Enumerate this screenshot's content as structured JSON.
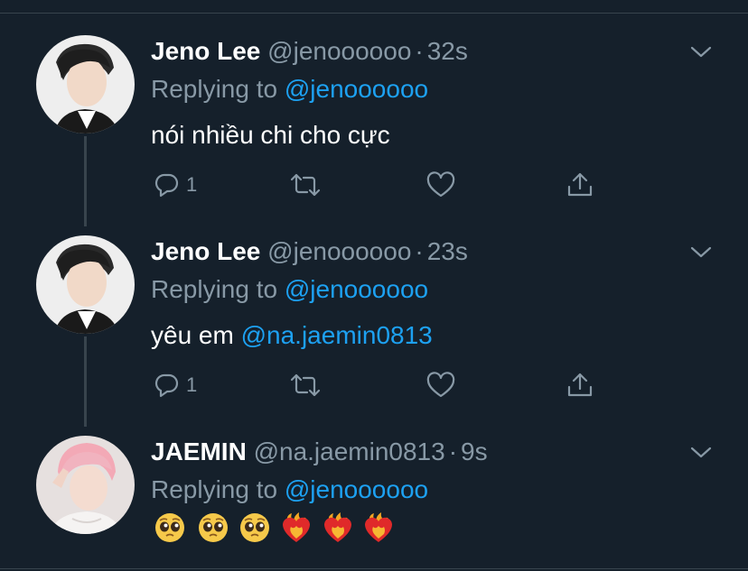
{
  "colors": {
    "background": "#15202b",
    "muted": "#8899a6",
    "accent": "#1da1f2",
    "divider": "#38444d"
  },
  "tweets": [
    {
      "name": "Jeno Lee",
      "handle": "@jenoooooo",
      "separator": "·",
      "time": "32s",
      "replying_prefix": "Replying to ",
      "replying_to": "@jenoooooo",
      "text": "nói nhiều chi cho cực",
      "reply_count": "1",
      "icons": [
        "reply-icon",
        "retweet-icon",
        "like-icon",
        "share-icon"
      ]
    },
    {
      "name": "Jeno Lee",
      "handle": "@jenoooooo",
      "separator": "·",
      "time": "23s",
      "replying_prefix": "Replying to ",
      "replying_to": "@jenoooooo",
      "text_prefix": "yêu em ",
      "text_mention": "@na.jaemin0813",
      "reply_count": "1",
      "icons": [
        "reply-icon",
        "retweet-icon",
        "like-icon",
        "share-icon"
      ]
    },
    {
      "name": "JAEMIN",
      "handle": "@na.jaemin0813",
      "separator": "·",
      "time": "9s",
      "replying_prefix": "Replying to ",
      "replying_to": "@jenoooooo",
      "emojis": [
        "pleading-face",
        "pleading-face",
        "pleading-face",
        "heart-on-fire",
        "heart-on-fire",
        "heart-on-fire"
      ]
    }
  ]
}
